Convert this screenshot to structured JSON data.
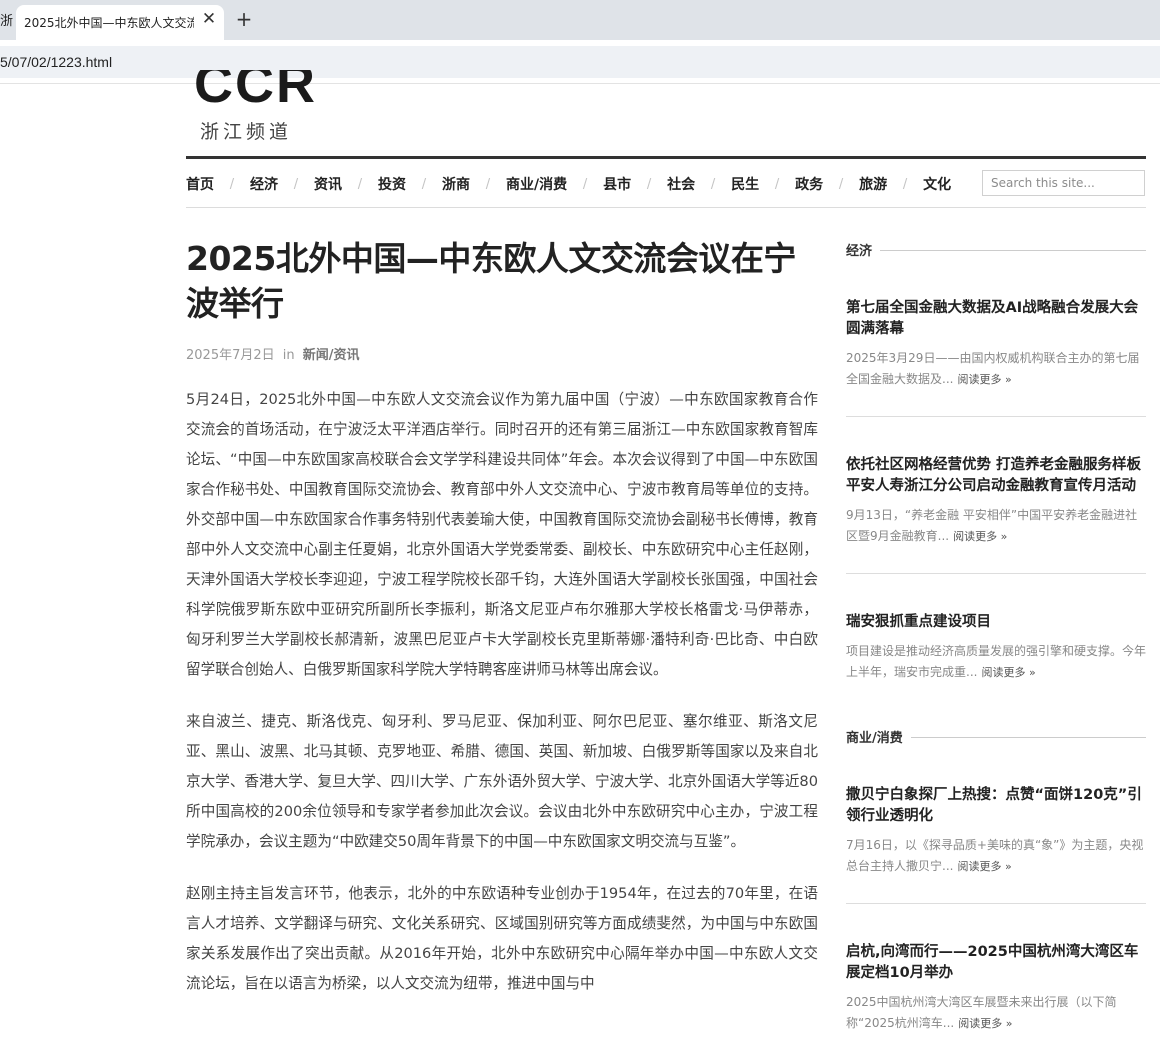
{
  "browser": {
    "tab_left_stub": "浙",
    "tab_title": "2025北外中国—中东欧人文交流会议在宁波举行",
    "close_glyph": "✕",
    "new_tab_glyph": "+",
    "url": "5/07/02/1223.html"
  },
  "site": {
    "logo_text": "CCR",
    "logo_sub": "浙江频道",
    "nav": [
      "首页",
      "经济",
      "资讯",
      "投资",
      "浙商",
      "商业/消费",
      "县市",
      "社会",
      "民生",
      "政务",
      "旅游",
      "文化"
    ],
    "nav_separator": "/",
    "search_placeholder": "Search this site..."
  },
  "article": {
    "title": "2025北外中国—中东欧人文交流会议在宁波举行",
    "date": "2025年7月2日",
    "in_word": "in",
    "category": "新闻/资讯",
    "paragraphs": [
      "5月24日，2025北外中国—中东欧人文交流会议作为第九届中国（宁波）—中东欧国家教育合作交流会的首场活动，在宁波泛太平洋酒店举行。同时召开的还有第三届浙江—中东欧国家教育智库论坛、“中国—中东欧国家高校联合会文学学科建设共同体”年会。本次会议得到了中国—中东欧国家合作秘书处、中国教育国际交流协会、教育部中外人文交流中心、宁波市教育局等单位的支持。外交部中国—中东欧国家合作事务特别代表姜瑜大使，中国教育国际交流协会副秘书长傅博，教育部中外人文交流中心副主任夏娟，北京外国语大学党委常委、副校长、中东欧研究中心主任赵刚，天津外国语大学校长李迎迎，宁波工程学院校长邵千钧，大连外国语大学副校长张国强，中国社会科学院俄罗斯东欧中亚研究所副所长李振利，斯洛文尼亚卢布尔雅那大学校长格雷戈·马伊蒂赤，匈牙利罗兰大学副校长郝清新，波黑巴尼亚卢卡大学副校长克里斯蒂娜·潘特利奇·巴比奇、中白欧留学联合创始人、白俄罗斯国家科学院大学特聘客座讲师马林等出席会议。",
      "来自波兰、捷克、斯洛伐克、匈牙利、罗马尼亚、保加利亚、阿尔巴尼亚、塞尔维亚、斯洛文尼亚、黑山、波黑、北马其顿、克罗地亚、希腊、德国、英国、新加坡、白俄罗斯等国家以及来自北京大学、香港大学、复旦大学、四川大学、广东外语外贸大学、宁波大学、北京外国语大学等近80所中国高校的200余位领导和专家学者参加此次会议。会议由北外中东欧研究中心主办，宁波工程学院承办，会议主题为“中欧建交50周年背景下的中国—中东欧国家文明交流与互鉴”。",
      "赵刚主持主旨发言环节，他表示，北外的中东欧语种专业创办于1954年，在过去的70年里，在语言人才培养、文学翻译与研究、文化关系研究、区域国别研究等方面成绩斐然，为中国与中东欧国家关系发展作出了突出贡献。从2016年开始，北外中东欧研究中心隔年举办中国—中东欧人文交流论坛，旨在以语言为桥梁，以人文交流为纽带，推进中国与中"
    ]
  },
  "sidebar": {
    "sections": [
      {
        "heading": "经济",
        "items": [
          {
            "title": "第七届全国金融大数据及AI战略融合发展大会圆满落幕",
            "excerpt": "2025年3月29日——由国内权威机构联合主办的第七届全国金融大数据及...",
            "more": "阅读更多 »"
          },
          {
            "title": "依托社区网格经营优势 打造养老金融服务样板 平安人寿浙江分公司启动金融教育宣传月活动",
            "excerpt": "9月13日，“养老金融 平安相伴”中国平安养老金融进社区暨9月金融教育...",
            "more": "阅读更多 »"
          },
          {
            "title": "瑞安狠抓重点建设项目",
            "excerpt": "项目建设是推动经济高质量发展的强引擎和硬支撑。今年上半年，瑞安市完成重...",
            "more": "阅读更多 »"
          }
        ]
      },
      {
        "heading": "商业/消费",
        "items": [
          {
            "title": "撒贝宁白象探厂上热搜：点赞“面饼120克”引领行业透明化",
            "excerpt": "7月16日，以《探寻品质+美味的真“象”》为主题，央视总台主持人撒贝宁...",
            "more": "阅读更多 »"
          },
          {
            "title": "启杭,向湾而行——2025中国杭州湾大湾区车展定档10月举办",
            "excerpt": "2025中国杭州湾大湾区车展暨未来出行展（以下简称“2025杭州湾车...",
            "more": "阅读更多 »"
          }
        ]
      }
    ]
  }
}
